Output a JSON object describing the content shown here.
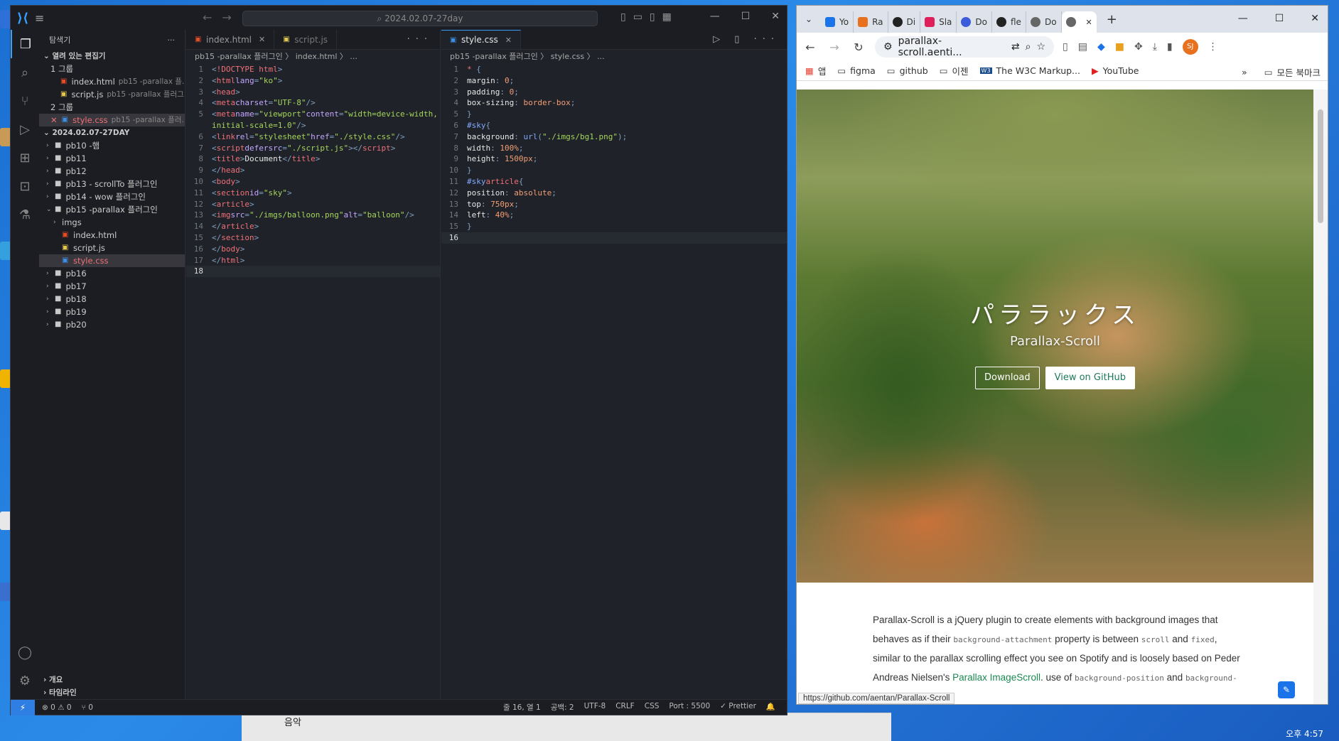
{
  "colors": {
    "vscode_bg": "#1f2229",
    "accent": "#3aa0ff",
    "chrome_tabs": "#dee3eb",
    "link_green": "#1b8a50"
  },
  "taskbar": {
    "item": "음악",
    "clock": "오후 4:57"
  },
  "vscode": {
    "search": "2024.02.07-27day",
    "explorer_title": "탐색기",
    "open_editors": "열려 있는 편집기",
    "group1": "1 그룹",
    "group2": "2 그룹",
    "open_files": [
      {
        "name": "index.html",
        "path": "pb15 -parallax 플..."
      },
      {
        "name": "script.js",
        "path": "pb15 -parallax 플러그..."
      },
      {
        "name": "style.css",
        "path": "pb15 -parallax 플러..."
      }
    ],
    "workspace": "2024.02.07-27DAY",
    "folders": [
      "pb10 -햄",
      "pb11",
      "pb12",
      "pb13 - scrollTo 플러그인",
      "pb14 - wow 플러그인",
      "pb15 -parallax 플러그인"
    ],
    "pb15_children": [
      "imgs",
      "index.html",
      "script.js",
      "style.css"
    ],
    "folders_after": [
      "pb16",
      "pb17",
      "pb18",
      "pb19",
      "pb20"
    ],
    "outline": "개요",
    "timeline": "타임라인",
    "left_tabs": [
      "index.html",
      "script.js"
    ],
    "left_crumb": "pb15 -parallax 플러그인 〉 index.html 〉 ...",
    "right_tab": "style.css",
    "right_crumb": "pb15 -parallax 플러그인 〉 style.css 〉 ...",
    "status": {
      "errors": "⊗ 0 ⚠ 0",
      "ports": "⑂ 0",
      "position": "줄 16, 열 1",
      "spaces": "공백: 2",
      "encoding": "UTF-8",
      "eol": "CRLF",
      "lang": "CSS",
      "port": "Port : 5500",
      "prettier": "✓ Prettier"
    }
  },
  "chrome": {
    "tabs": [
      "Yo",
      "Ra",
      "Di",
      "Sla",
      "Do",
      "fle",
      "Do",
      ""
    ],
    "url": "parallax-scroll.aenti...",
    "bookmarks": [
      "앱",
      "figma",
      "github",
      "이젠",
      "The W3C Markup...",
      "YouTube"
    ],
    "all_bookmarks": "모든 북마크",
    "avatar": "SJ",
    "hero_title": "パララックス",
    "hero_sub": "Parallax-Scroll",
    "btn_download": "Download",
    "btn_github": "View on GitHub",
    "status_url": "https://github.com/aentan/Parallax-Scroll",
    "p1": "Parallax-Scroll is a jQuery plugin to create elements with background images that behaves as if their",
    "p1_code": "background-attachment",
    "p2": "property is between",
    "p2_code": "scroll",
    "p3": "and",
    "p3_code": "fixed",
    "p4": ", similar to the parallax scrolling effect you see on Spotify and is loosely based on Peder Andreas Nielsen's",
    "p4_link": "Parallax ImageScroll",
    "p5": "use of",
    "p5_code1": "background-position",
    "p5_and": "and",
    "p5_code2": "background-size"
  }
}
